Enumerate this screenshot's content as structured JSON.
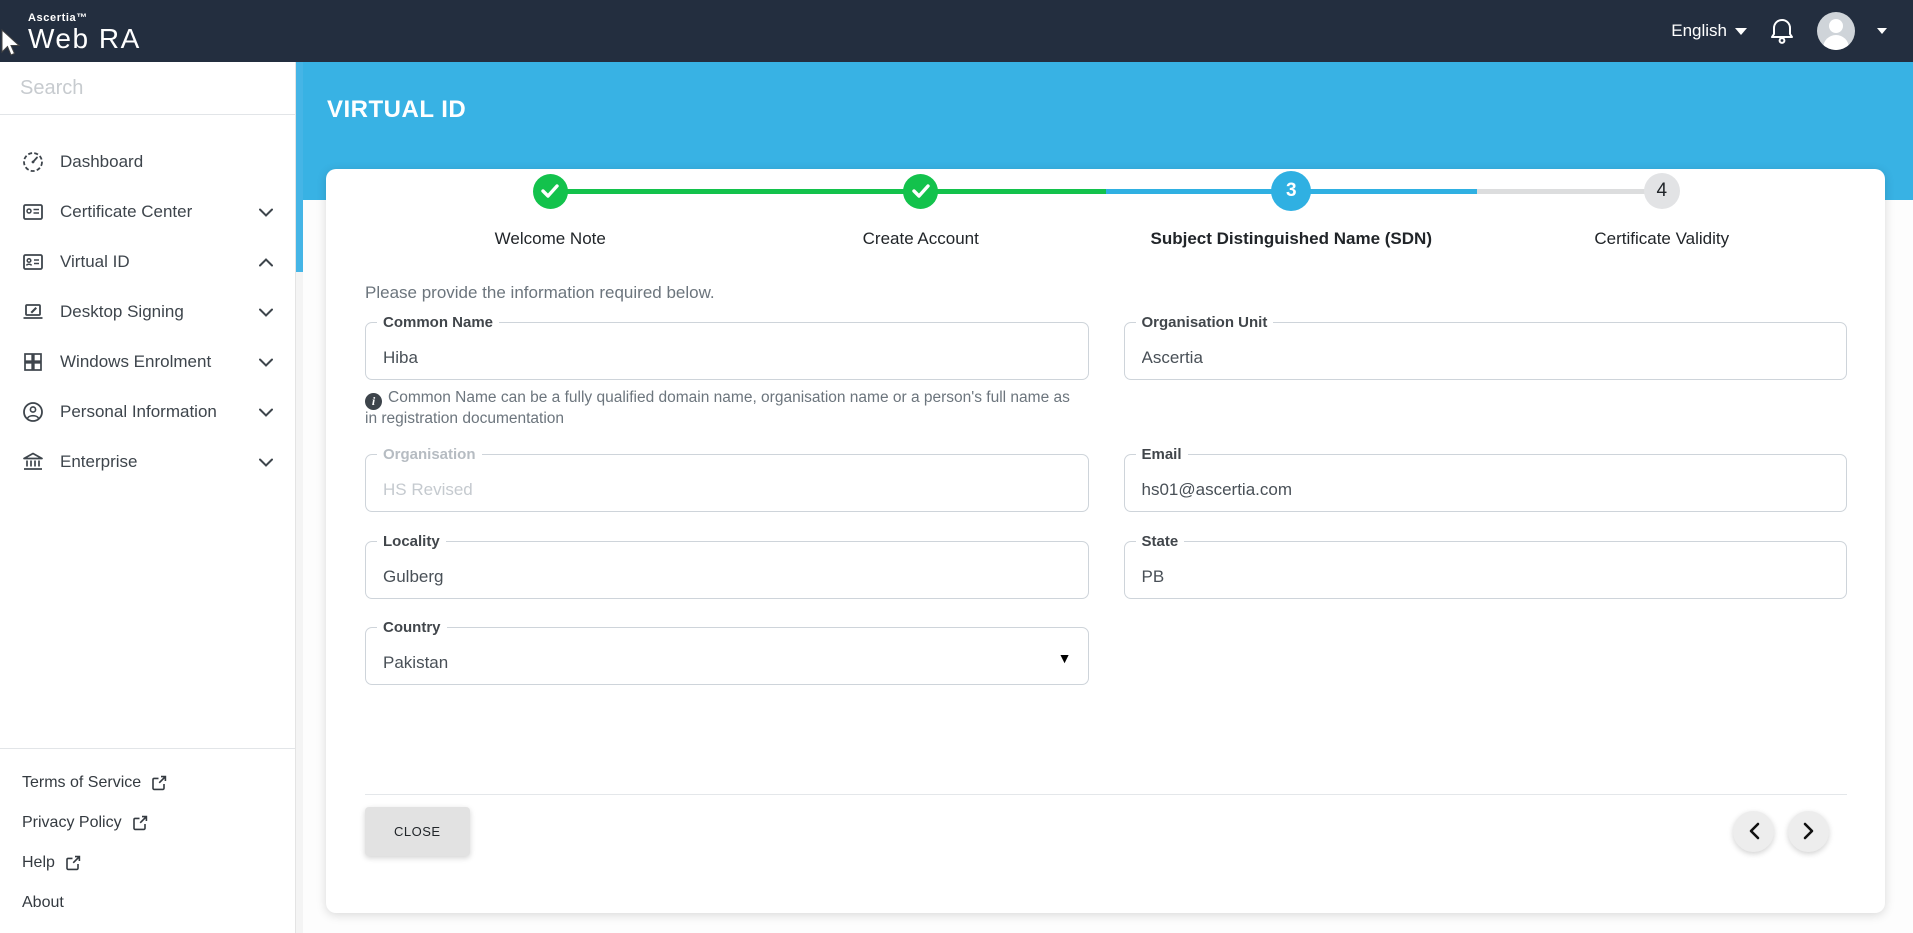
{
  "navbar": {
    "brand_top": "Ascertia™",
    "brand_main": "Web RA",
    "language": "English"
  },
  "sidebar": {
    "search_placeholder": "Search",
    "items": [
      {
        "label": "Dashboard"
      },
      {
        "label": "Certificate Center"
      },
      {
        "label": "Virtual ID"
      },
      {
        "label": "Desktop Signing"
      },
      {
        "label": "Windows Enrolment"
      },
      {
        "label": "Personal Information"
      },
      {
        "label": "Enterprise"
      }
    ],
    "footer_links": [
      {
        "label": "Terms of Service"
      },
      {
        "label": "Privacy Policy"
      },
      {
        "label": "Help"
      },
      {
        "label": "About"
      }
    ]
  },
  "page": {
    "title": "VIRTUAL ID"
  },
  "stepper": {
    "steps": [
      {
        "label": "Welcome Note",
        "state": "complete"
      },
      {
        "label": "Create Account",
        "state": "complete"
      },
      {
        "label": "Subject Distinguished Name (SDN)",
        "state": "active",
        "number": "3"
      },
      {
        "label": "Certificate Validity",
        "state": "upcoming",
        "number": "4"
      }
    ]
  },
  "form": {
    "intro": "Please provide the information required below.",
    "hint": "Common Name can be a fully qualified domain name, organisation name or a person's full name as in registration documentation",
    "fields": {
      "common_name": {
        "label": "Common Name",
        "value": "Hiba"
      },
      "organisation_unit": {
        "label": "Organisation Unit",
        "value": "Ascertia"
      },
      "organisation": {
        "label": "Organisation",
        "value": "HS Revised",
        "disabled": true
      },
      "email": {
        "label": "Email",
        "value": "hs01@ascertia.com"
      },
      "locality": {
        "label": "Locality",
        "value": "Gulberg"
      },
      "state": {
        "label": "State",
        "value": "PB"
      },
      "country": {
        "label": "Country",
        "value": "Pakistan"
      }
    },
    "close_label": "CLOSE"
  },
  "colors": {
    "navbar": "#232e3f",
    "accent_blue": "#38b2e4",
    "success_green": "#13c24c",
    "inactive_gray": "#e2e3e5"
  }
}
